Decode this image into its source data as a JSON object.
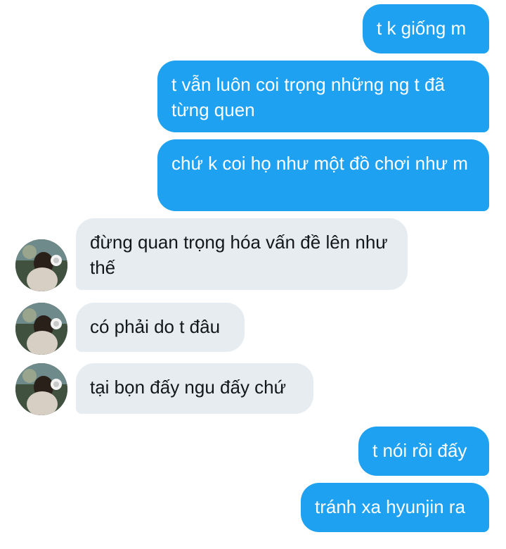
{
  "messages": [
    {
      "from": "me",
      "text": "t k giống m"
    },
    {
      "from": "me",
      "text": "t vẫn luôn coi trọng những ng t đã từng quen"
    },
    {
      "from": "me",
      "text": "chứ k coi họ như một đồ chơi như m"
    },
    {
      "from": "them",
      "text": "đừng quan trọng hóa vấn đề lên như thế"
    },
    {
      "from": "them",
      "text": "có phải do t đâu"
    },
    {
      "from": "them",
      "text": "tại bọn đấy ngu đấy chứ"
    },
    {
      "from": "me",
      "text": "t nói rồi đấy"
    },
    {
      "from": "me",
      "text": "tránh xa hyunjin ra"
    }
  ],
  "colors": {
    "sent_bubble": "#1ea1f1",
    "received_bubble": "#e6ecf0",
    "sent_text": "#ffffff",
    "received_text": "#14171a"
  },
  "icons": {
    "avatar": "user-avatar-photo"
  }
}
